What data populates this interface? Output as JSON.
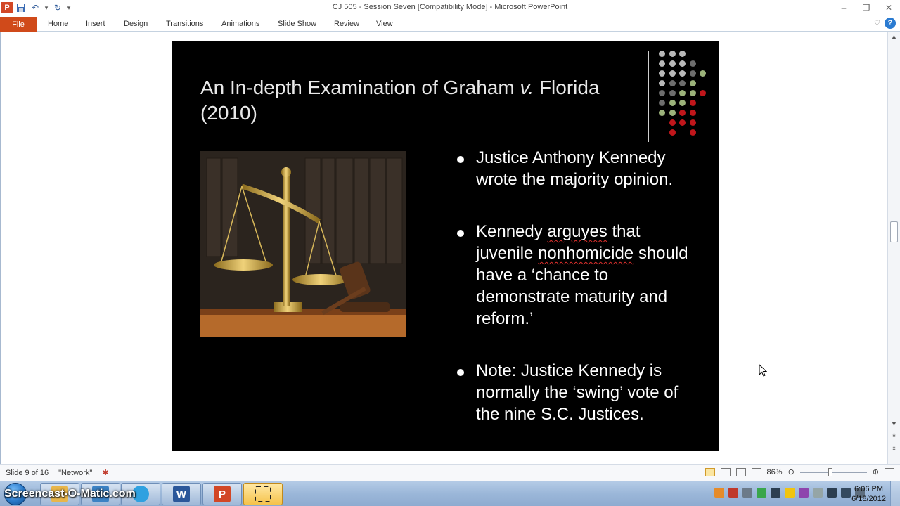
{
  "window": {
    "title": "CJ 505 - Session Seven [Compatibility Mode] - Microsoft PowerPoint"
  },
  "ribbon": {
    "file_tab": "File",
    "tabs": [
      "Home",
      "Insert",
      "Design",
      "Transitions",
      "Animations",
      "Slide Show",
      "Review",
      "View"
    ]
  },
  "slide": {
    "title_part1": "An In-depth Examination of Graham ",
    "title_italic": "v.",
    "title_part2": " Florida (2010)",
    "bullets": [
      {
        "text": "Justice Anthony Kennedy wrote the majority opinion."
      },
      {
        "pre": "Kennedy ",
        "sq1": "arguyes",
        "mid": " that juvenile ",
        "sq2": "nonhomicide",
        "post": " should have a ‘chance to demonstrate maturity and reform.’"
      },
      {
        "text": "Note:  Justice Kennedy is normally the ‘swing’ vote of the nine S.C. Justices."
      }
    ],
    "accent_colors": {
      "gray": "#b8b8b8",
      "green": "#9bb27a",
      "red": "#c0161b",
      "darkgray": "#6d6d6d"
    }
  },
  "statusbar": {
    "slide_info": "Slide 9 of 16",
    "theme": "\"Network\"",
    "zoom": "86%"
  },
  "taskbar": {
    "watermark": "Screencast-O-Matic.com",
    "apps": [
      {
        "icon": "W",
        "color": "#2b579a"
      },
      {
        "icon": "P",
        "color": "#d24726"
      }
    ],
    "time": "6:06 PM",
    "date": "6/18/2012"
  }
}
